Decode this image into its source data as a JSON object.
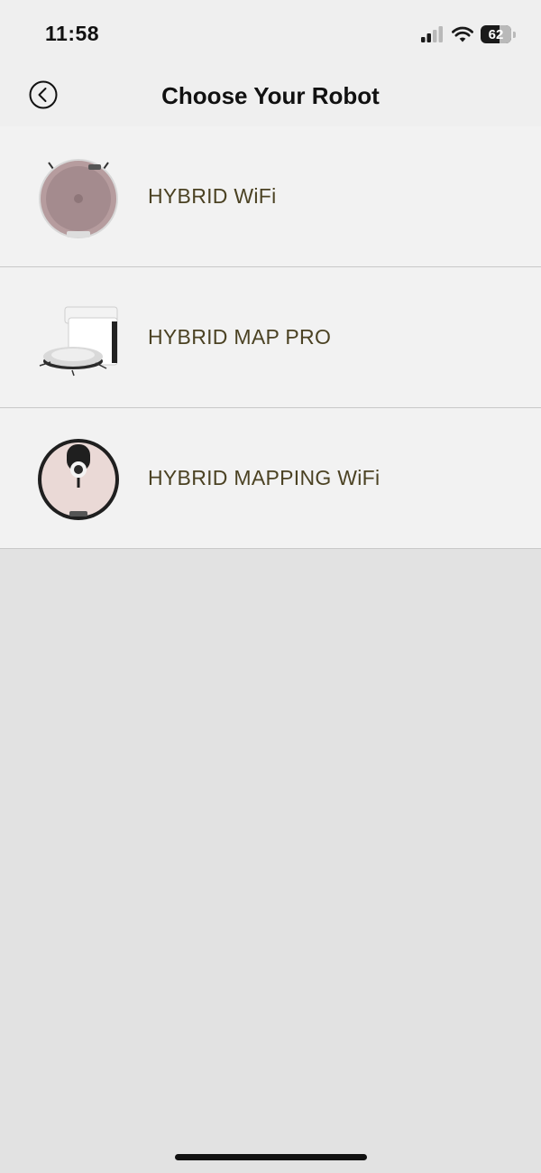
{
  "status_bar": {
    "time": "11:58",
    "battery_percent": "62",
    "battery_level": 0.62,
    "icons": [
      "cellular-signal-icon",
      "wifi-icon",
      "battery-icon"
    ]
  },
  "header": {
    "back_icon": "chevron-left-circle-icon",
    "title": "Choose Your Robot"
  },
  "robots": [
    {
      "label": "HYBRID WiFi",
      "image": "robot-vacuum-rose-icon"
    },
    {
      "label": "HYBRID MAP PRO",
      "image": "robot-vacuum-with-dock-icon"
    },
    {
      "label": "HYBRID MAPPING WiFi",
      "image": "robot-vacuum-lidar-icon"
    }
  ],
  "colors": {
    "label_text": "#4b4223",
    "list_background": "#f2f2f2",
    "page_background": "#e2e2e2"
  }
}
